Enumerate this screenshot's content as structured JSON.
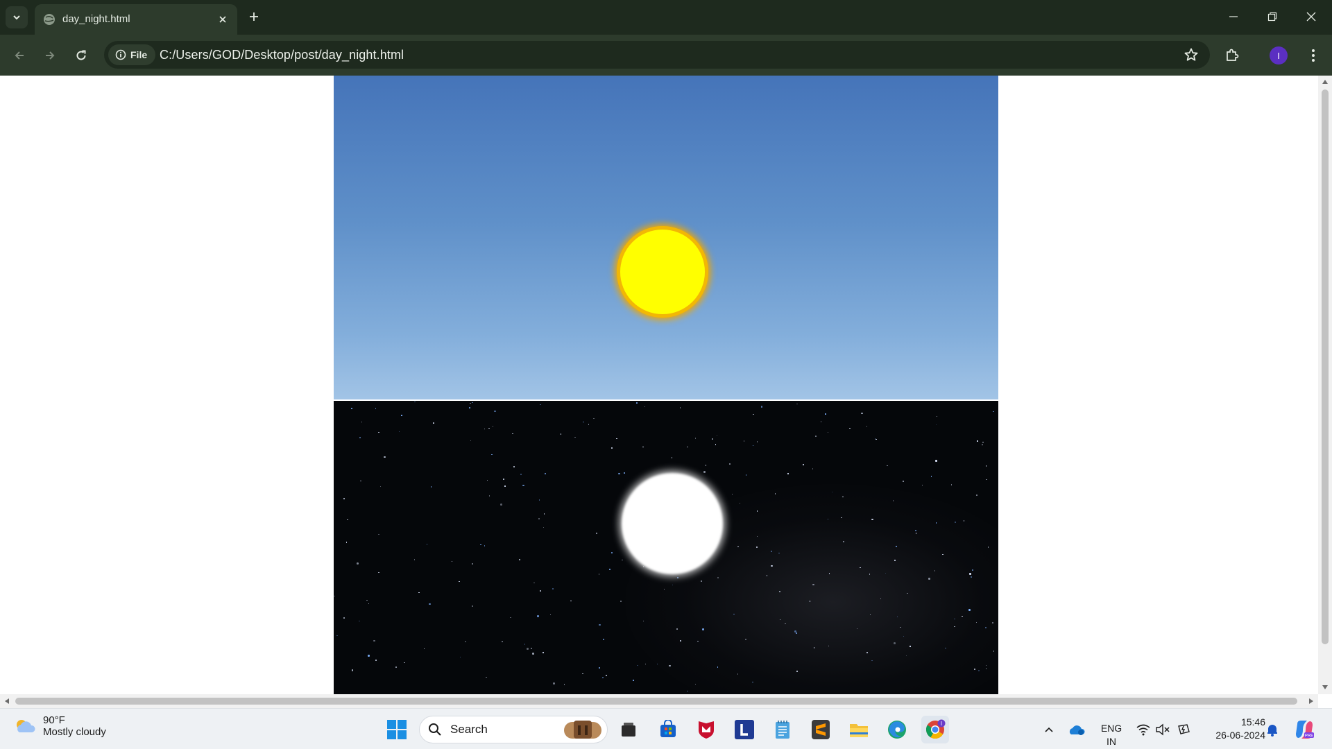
{
  "browser": {
    "tab": {
      "title": "day_night.html",
      "favicon": "globe-icon"
    },
    "address": {
      "scheme_label": "File",
      "url": "C:/Users/GOD/Desktop/post/day_night.html"
    },
    "profile_initial": "I",
    "colors": {
      "chrome": "#1e2a1e",
      "toolbar": "#2d3b2c",
      "avatar": "#5b2fc2"
    }
  },
  "page": {
    "day_panel": {
      "sky_top": "#4574b9",
      "sky_bottom": "#a2c4e6",
      "sun_color": "#ffff00",
      "sun_rim": "#f2b705"
    },
    "night_panel": {
      "sky": "#05070a",
      "moon_color": "#ffffff"
    }
  },
  "taskbar": {
    "weather": {
      "temp": "90°F",
      "condition": "Mostly cloudy",
      "icon": "cloud-icon"
    },
    "search_placeholder": "Search",
    "language": {
      "line1": "ENG",
      "line2": "IN"
    },
    "clock": {
      "time": "15:46",
      "date": "26-06-2024"
    },
    "pinned": [
      "windows-start-icon",
      "search-icon",
      "file-explorer-window-icon",
      "microsoft-store-icon",
      "mcafee-icon",
      "l-app-icon",
      "notepad-icon",
      "sublime-text-icon",
      "file-explorer-icon",
      "edge-icon",
      "chrome-icon"
    ]
  }
}
